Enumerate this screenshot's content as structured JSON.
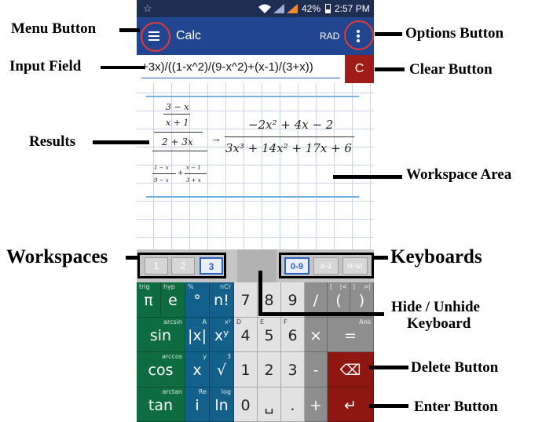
{
  "status_bar": {
    "battery": "42%",
    "time": "2:57 PM"
  },
  "app_bar": {
    "title": "Calc",
    "angle_mode": "RAD"
  },
  "input": {
    "value": "+3x)/((1-x^2)/(9-x^2)+(x-1)/(3+x))",
    "clear_label": "C"
  },
  "result": {
    "lhs": {
      "top_num": "3 − x",
      "top_den": "x + 1",
      "mid": "2 + 3x",
      "bot1_num": "1 − x",
      "bot1_den": "9 − x",
      "bot2_num": "x − 1",
      "bot2_den": "3 + x"
    },
    "arrow": "→",
    "rhs_num": "−2x² + 4x − 2",
    "rhs_den": "3x³ + 14x² + 17x + 6"
  },
  "workspaces": [
    "1",
    "2",
    "3"
  ],
  "active_workspace": "3",
  "keyboards": [
    "0-9",
    "a-z",
    "α-ω"
  ],
  "active_keyboard": "0-9",
  "keys": {
    "row1": [
      {
        "main": "π",
        "top_left": "trig"
      },
      {
        "main": "e",
        "top_left": "hyp"
      },
      {
        "main": "°",
        "top_left": "%"
      },
      {
        "main": "n!",
        "top_left": "nCr"
      },
      {
        "main": "7"
      },
      {
        "main": "8"
      },
      {
        "main": "9"
      },
      {
        "main": "/"
      },
      {
        "main": "(",
        "top_left": "[",
        "top_right": "|<"
      },
      {
        "main": ")",
        "top_left": "]",
        "top_right": ">|"
      }
    ],
    "row2": [
      {
        "main": "sin",
        "top_right": "arcsin"
      },
      {
        "main": "|x|",
        "top_right": "A"
      },
      {
        "main": "xʸ",
        "top_right": "x²"
      },
      {
        "main": "4",
        "top_left": "D"
      },
      {
        "main": "5",
        "top_left": "E"
      },
      {
        "main": "6",
        "top_left": "F"
      },
      {
        "main": "×"
      },
      {
        "main": "=",
        "top_right": "Ans"
      }
    ],
    "row3": [
      {
        "main": "cos",
        "top_right": "arccos"
      },
      {
        "main": "x",
        "top_right": "y"
      },
      {
        "main": "√",
        "top_right": "3"
      },
      {
        "main": "1"
      },
      {
        "main": "2"
      },
      {
        "main": "3"
      },
      {
        "main": "-"
      },
      {
        "main": "⌫"
      }
    ],
    "row4": [
      {
        "main": "tan",
        "top_right": "arctan"
      },
      {
        "main": "i",
        "top_right": "Re"
      },
      {
        "main": "ln",
        "top_right": "log"
      },
      {
        "main": "0"
      },
      {
        "main": "␣"
      },
      {
        "main": "."
      },
      {
        "main": "+"
      },
      {
        "main": "↵"
      }
    ]
  },
  "annotations": {
    "menu_button": "Menu Button",
    "options_button": "Options Button",
    "input_field": "Input Field",
    "clear_button": "Clear Button",
    "results": "Results",
    "workspace_area": "Workspace Area",
    "workspaces": "Workspaces",
    "keyboards": "Keyboards",
    "hide_unhide_line1": "Hide / Unhide",
    "hide_unhide_line2": "Keyboard",
    "delete_button": "Delete Button",
    "enter_button": "Enter Button"
  },
  "colors": {
    "app_bar": "#21468f",
    "status_bar": "#1e2e52",
    "clear_button": "#a01c16",
    "trig_keys": "#0f6b40",
    "func_keys": "#13608a",
    "annotation_ring": "#e53935"
  }
}
